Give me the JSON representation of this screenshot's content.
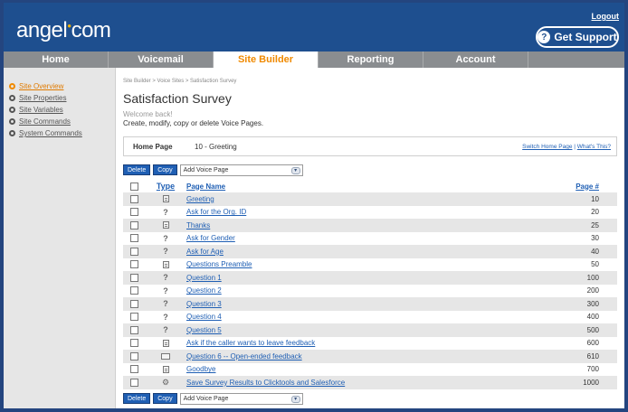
{
  "header": {
    "logo_main": "angel",
    "logo_dot": "●",
    "logo_end": "com",
    "logout": "Logout",
    "support": "Get Support"
  },
  "nav": {
    "items": [
      "Home",
      "Voicemail",
      "Site Builder",
      "Reporting",
      "Account"
    ],
    "active": "Site Builder"
  },
  "sidebar": {
    "items": [
      "Site Overview",
      "Site Properties",
      "Site Variables",
      "Site Commands",
      "System Commands"
    ]
  },
  "main": {
    "breadcrumb": "Site Builder > Voice Sites > Satisfaction Survey",
    "title": "Satisfaction Survey",
    "welcome": "Welcome back!",
    "description": "Create, modify, copy or delete Voice Pages.",
    "home_page_label": "Home Page",
    "home_page_value": "10 - Greeting",
    "switch_link": "Switch Home Page",
    "whats_this": "What's This?",
    "delete": "Delete",
    "copy": "Copy",
    "add_page": "Add Voice Page",
    "dropdown_arrow": "▾",
    "columns": {
      "type": "Type",
      "name": "Page Name",
      "page": "Page #"
    },
    "pages": [
      {
        "icon": "doc",
        "name": "Greeting",
        "num": "10"
      },
      {
        "icon": "question",
        "name": "Ask for the Org. ID",
        "num": "20"
      },
      {
        "icon": "doc",
        "name": "Thanks",
        "num": "25"
      },
      {
        "icon": "question",
        "name": "Ask for Gender",
        "num": "30"
      },
      {
        "icon": "question",
        "name": "Ask for Age",
        "num": "40"
      },
      {
        "icon": "doc",
        "name": "Questions Preamble",
        "num": "50"
      },
      {
        "icon": "question",
        "name": "Question 1",
        "num": "100"
      },
      {
        "icon": "question",
        "name": "Question 2",
        "num": "200"
      },
      {
        "icon": "question",
        "name": "Question 3",
        "num": "300"
      },
      {
        "icon": "question",
        "name": "Question 4",
        "num": "400"
      },
      {
        "icon": "question",
        "name": "Question 5",
        "num": "500"
      },
      {
        "icon": "doc",
        "name": "Ask if the caller wants to leave feedback",
        "num": "600"
      },
      {
        "icon": "wide",
        "name": "Question 6 -- Open-ended feedback",
        "num": "610"
      },
      {
        "icon": "doc",
        "name": "Goodbye",
        "num": "700"
      },
      {
        "icon": "branch",
        "name": "Save Survey Results to Clicktools and Salesforce",
        "num": "1000"
      }
    ]
  }
}
